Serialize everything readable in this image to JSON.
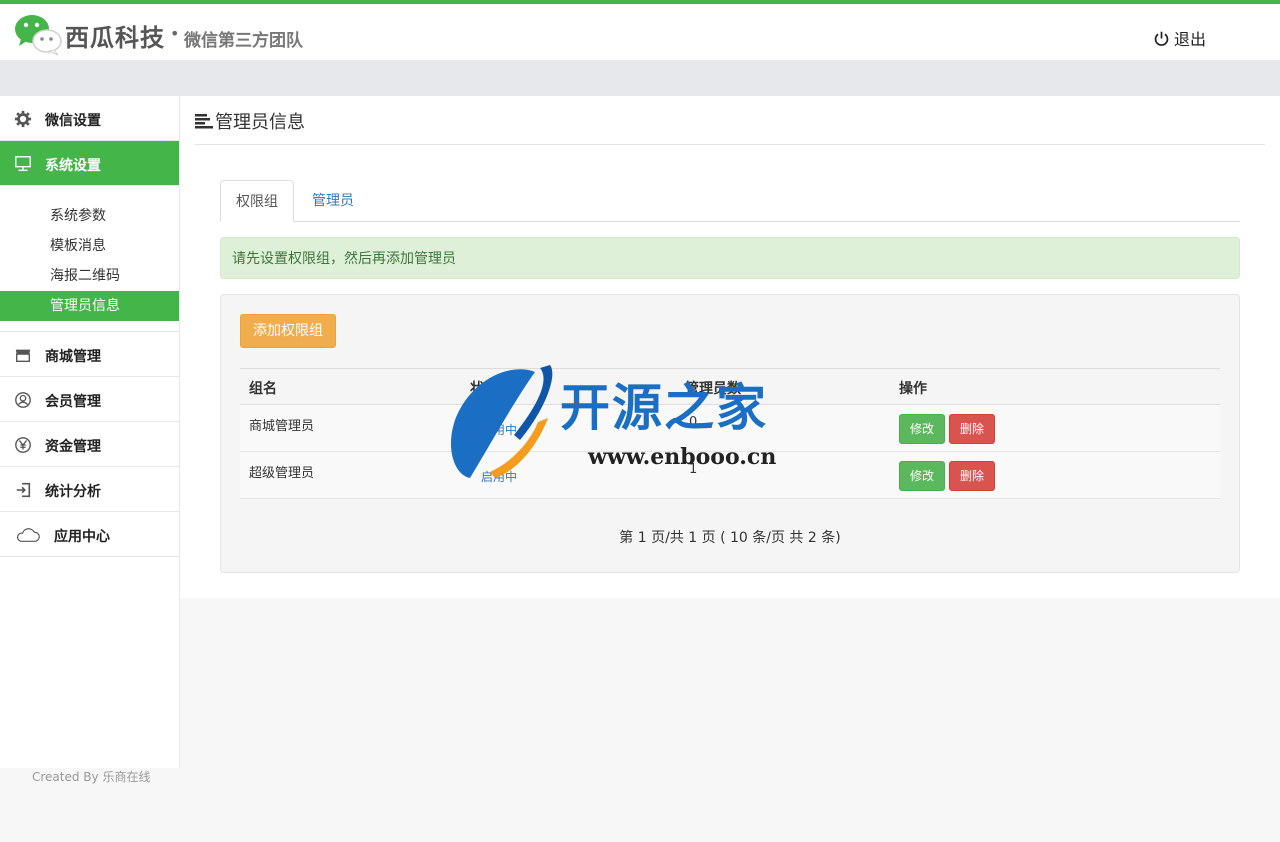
{
  "header": {
    "brand": "西瓜科技",
    "dot": "•",
    "subtitle": "微信第三方团队",
    "logout_label": "退出"
  },
  "sidebar": {
    "items": [
      {
        "label": "微信设置",
        "icon": "gear-icon"
      },
      {
        "label": "系统设置",
        "icon": "monitor-icon",
        "active": true
      },
      {
        "label": "商城管理",
        "icon": "store-icon"
      },
      {
        "label": "会员管理",
        "icon": "user-icon"
      },
      {
        "label": "资金管理",
        "icon": "yen-icon"
      },
      {
        "label": "统计分析",
        "icon": "sign-in-icon"
      },
      {
        "label": "应用中心",
        "icon": "cloud-icon"
      }
    ],
    "submenu": [
      "系统参数",
      "模板消息",
      "海报二维码",
      "管理员信息"
    ],
    "active_sub": "管理员信息",
    "footer": "Created By 乐商在线"
  },
  "main": {
    "title": "管理员信息",
    "tabs": [
      "权限组",
      "管理员"
    ],
    "alert": "请先设置权限组，然后再添加管理员",
    "add_button": "添加权限组",
    "table": {
      "headers": [
        "组名",
        "状态",
        "管理员数",
        "操作"
      ],
      "rows": [
        {
          "name": "商城管理员",
          "status": "启用中",
          "count": "0"
        },
        {
          "name": "超级管理员",
          "status": "启用中",
          "count": "1"
        }
      ],
      "edit_label": "修改",
      "delete_label": "删除"
    },
    "pagination": "第 1 页/共 1 页 ( 10 条/页 共 2 条)"
  },
  "watermark": {
    "title": "开源之家",
    "url": "www.enbooo.cn"
  },
  "colors": {
    "accent": "#44b549",
    "warning": "#f0ad4e",
    "success": "#5cb85c",
    "danger": "#d9534f",
    "link": "#337ab7"
  }
}
